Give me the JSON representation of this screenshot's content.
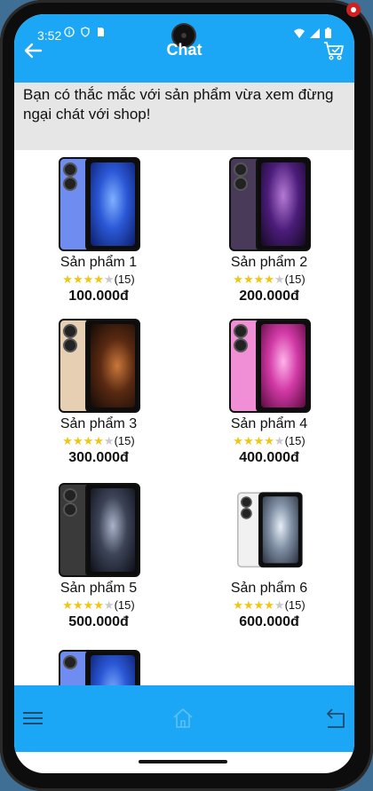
{
  "status": {
    "time": "3:52"
  },
  "appbar": {
    "title": "Chat"
  },
  "notice": {
    "text": "Bạn có thắc mắc với sản phẩm vừa xem đừng ngại chát với shop!"
  },
  "products": [
    {
      "name": "Sản phẩm 1",
      "rating": 4,
      "reviews": "(15)",
      "price": "100.000đ",
      "color": "#6f8cf0"
    },
    {
      "name": "Sản phẩm 2",
      "rating": 4,
      "reviews": "(15)",
      "price": "200.000đ",
      "color": "#4a3a5a"
    },
    {
      "name": "Sản phẩm 3",
      "rating": 4,
      "reviews": "(15)",
      "price": "300.000đ",
      "color": "#e7cfb3"
    },
    {
      "name": "Sản phẩm 4",
      "rating": 4,
      "reviews": "(15)",
      "price": "400.000đ",
      "color": "#f08fd5"
    },
    {
      "name": "Sản phẩm 5",
      "rating": 4,
      "reviews": "(15)",
      "price": "500.000đ",
      "color": "#3a3a3a"
    },
    {
      "name": "Sản phẩm 6",
      "rating": 4,
      "reviews": "(15)",
      "price": "600.000đ",
      "color": "#f1f1f1"
    }
  ],
  "icons": {
    "back": "arrow-left-icon",
    "cart": "cart-icon",
    "menu": "menu-icon",
    "home": "home-icon",
    "return": "return-icon"
  },
  "colors": {
    "primary": "#1ba7f5",
    "notice_bg": "#e6e6e6",
    "star": "#f2c511"
  }
}
